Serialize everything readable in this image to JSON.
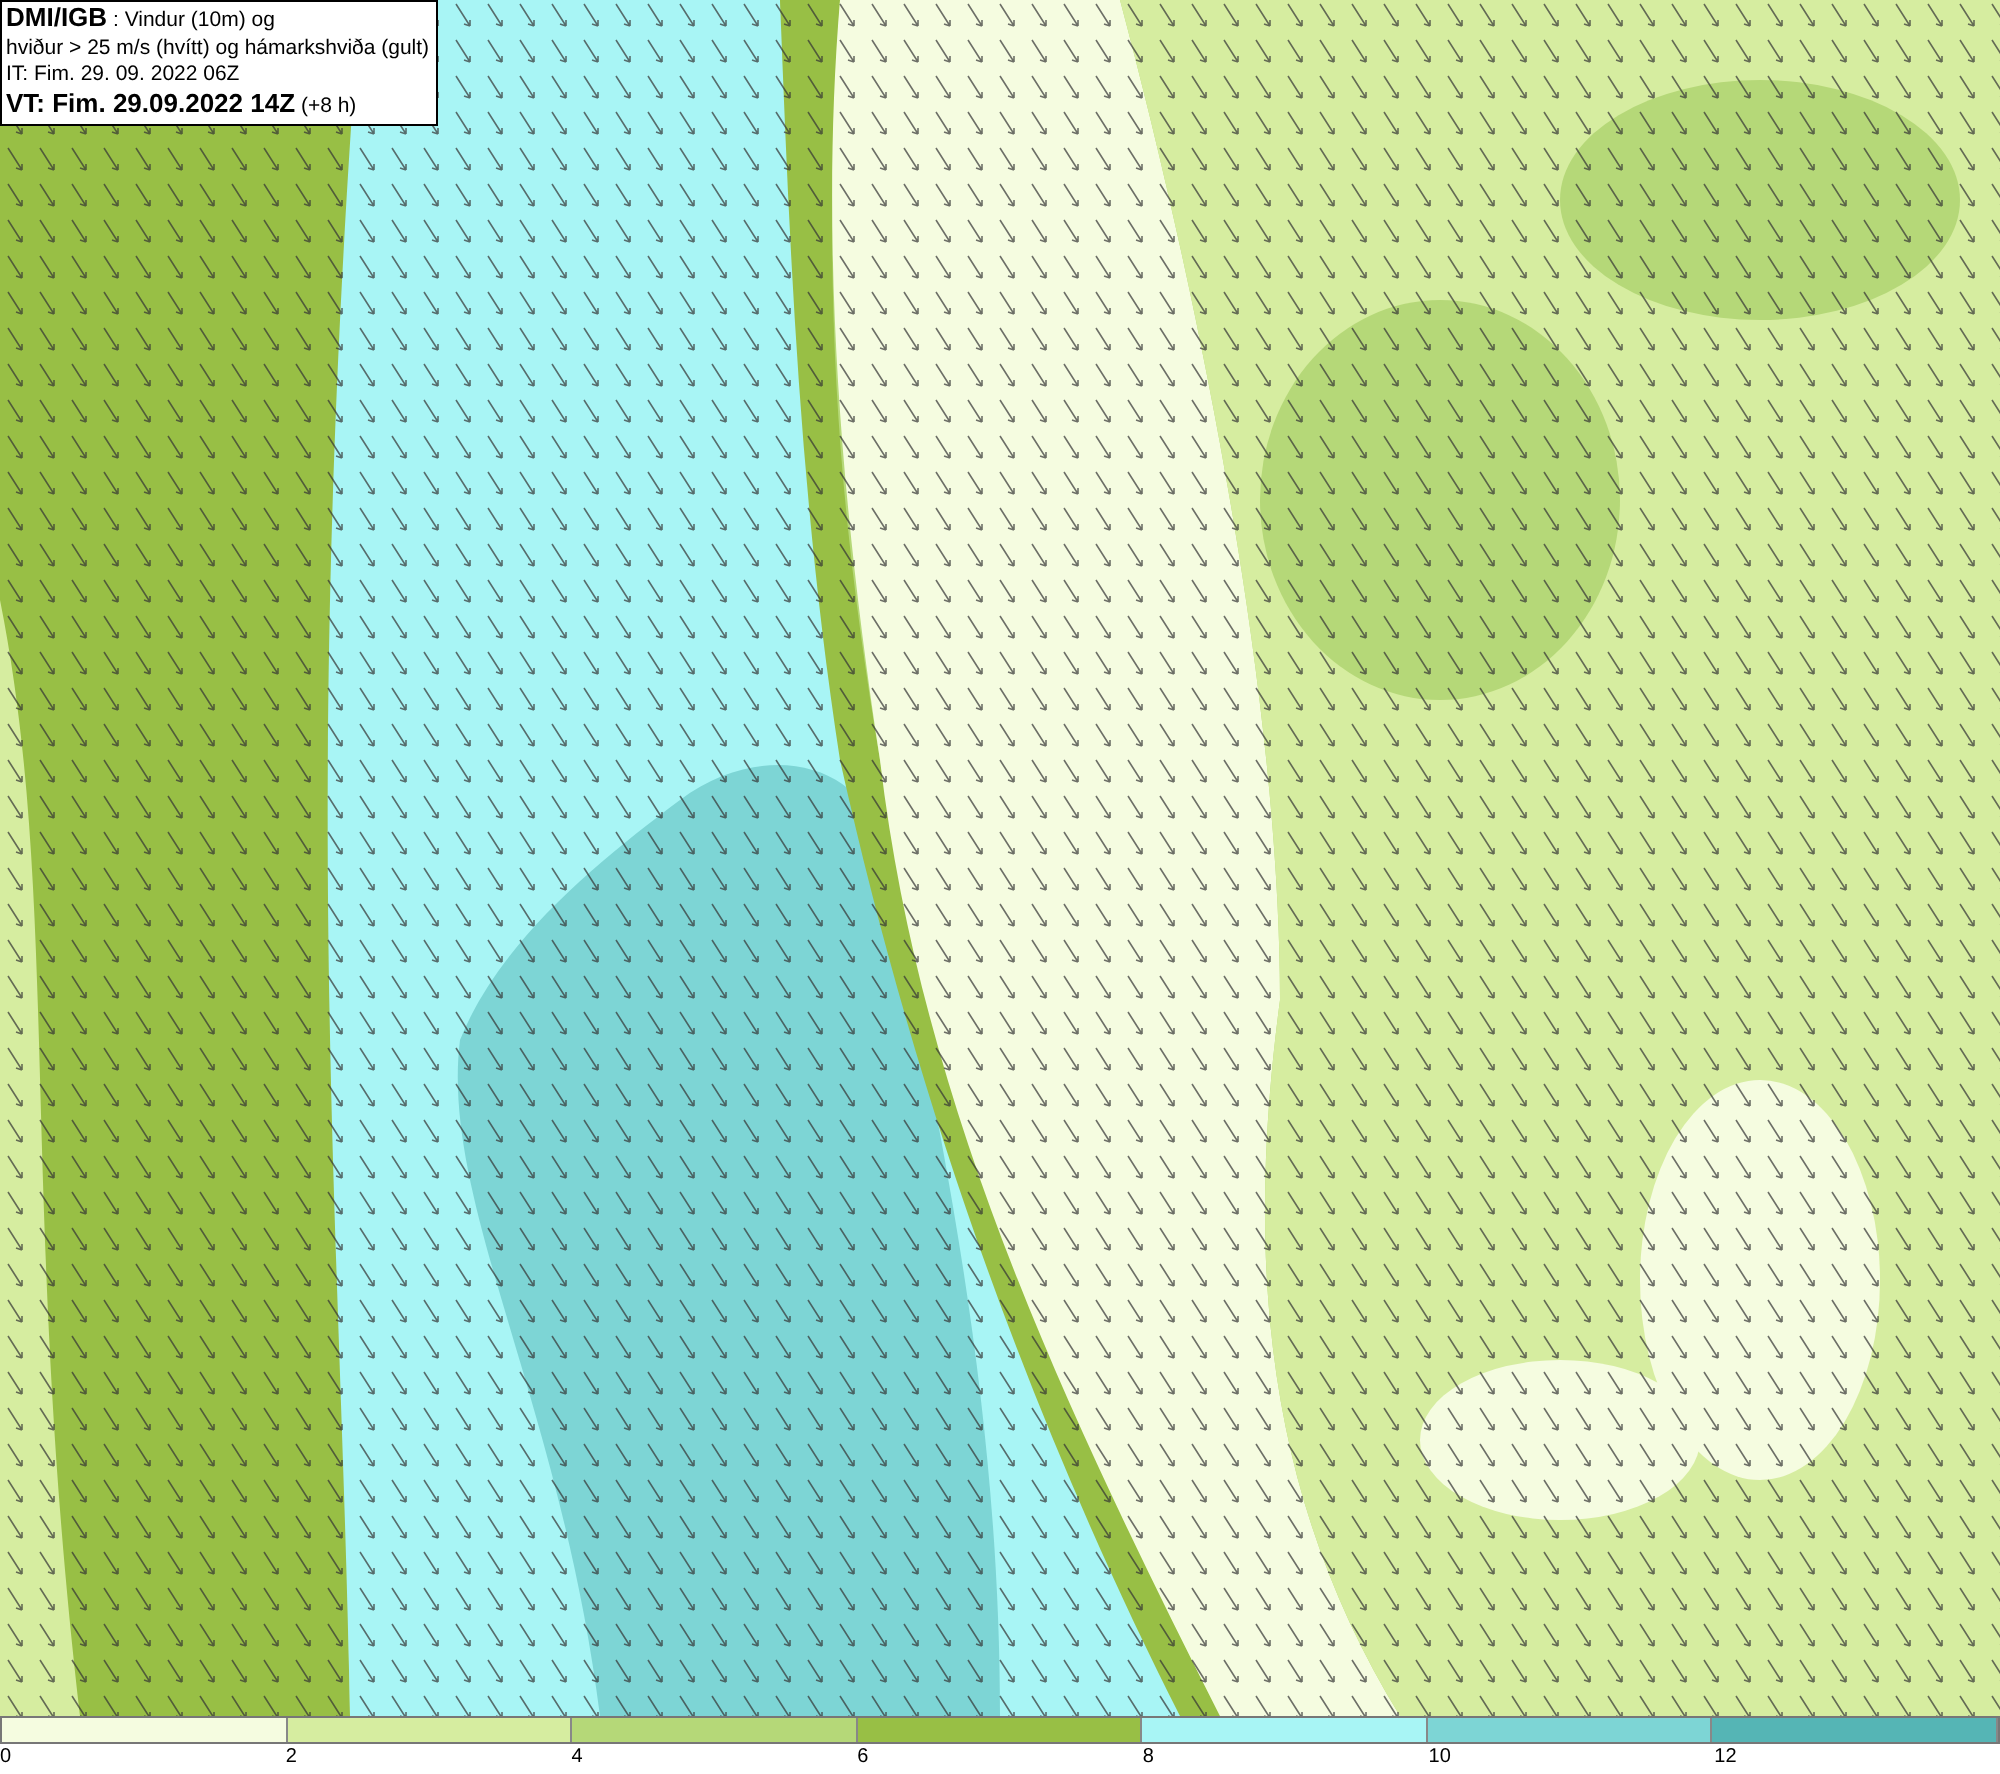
{
  "info_box": {
    "lines": [
      "**DMI/IGB** : Vindur (10m) og",
      "hviður > 25 m/s (hvítt) og hámarkshviða (gult)",
      "IT: Fim. 29. 09. 2022 06Z",
      "**VT: Fim. 29.09.2022 14Z** (+8 h)"
    ]
  },
  "legend": {
    "bands": [
      {
        "color": "#f5fce0"
      },
      {
        "color": "#d6eda0"
      },
      {
        "color": "#b5d878"
      },
      {
        "color": "#98bf45"
      },
      {
        "color": "#a8f5f5"
      },
      {
        "color": "#7dd5d5"
      },
      {
        "color": "#55b5b5"
      }
    ],
    "ticks": [
      "0",
      "2",
      "4",
      "6",
      "8",
      "10",
      "12"
    ]
  }
}
